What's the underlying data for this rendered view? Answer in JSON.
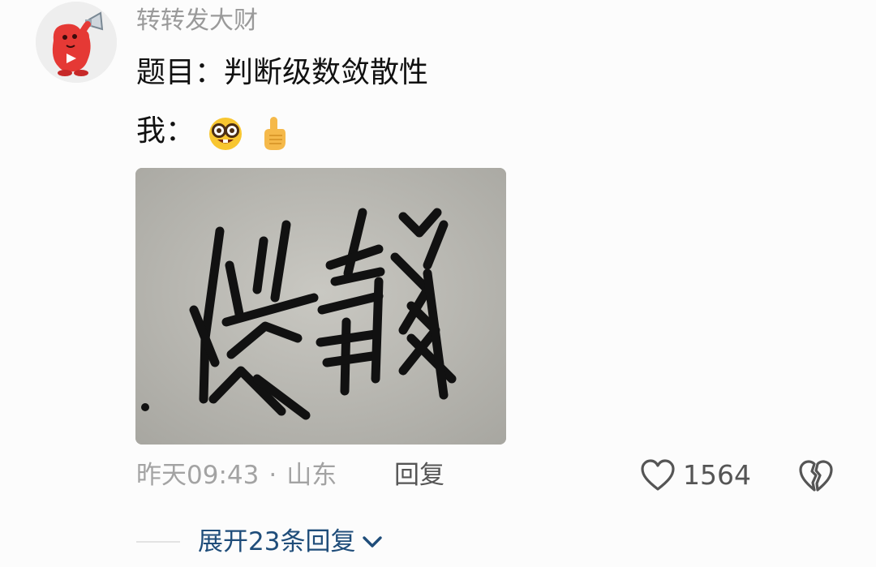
{
  "comment": {
    "username": "转转发大财",
    "question_line": "题目：判断级数敛散性",
    "answer_line": "我：",
    "answer_emojis": [
      "nerd-face",
      "index-pointing-up"
    ],
    "photo": {
      "description_icon": "handwritten-characters-photo"
    },
    "timestamp": "昨天09:43",
    "separator": "·",
    "location": "山东",
    "reply_label": "回复",
    "like_count": "1564",
    "expand_label": "展开23条回复"
  },
  "colors": {
    "username": "#9a9a9a",
    "meta": "#a3a3a3",
    "link_blue": "#1f4d7a",
    "avatar_red": "#e53935"
  }
}
